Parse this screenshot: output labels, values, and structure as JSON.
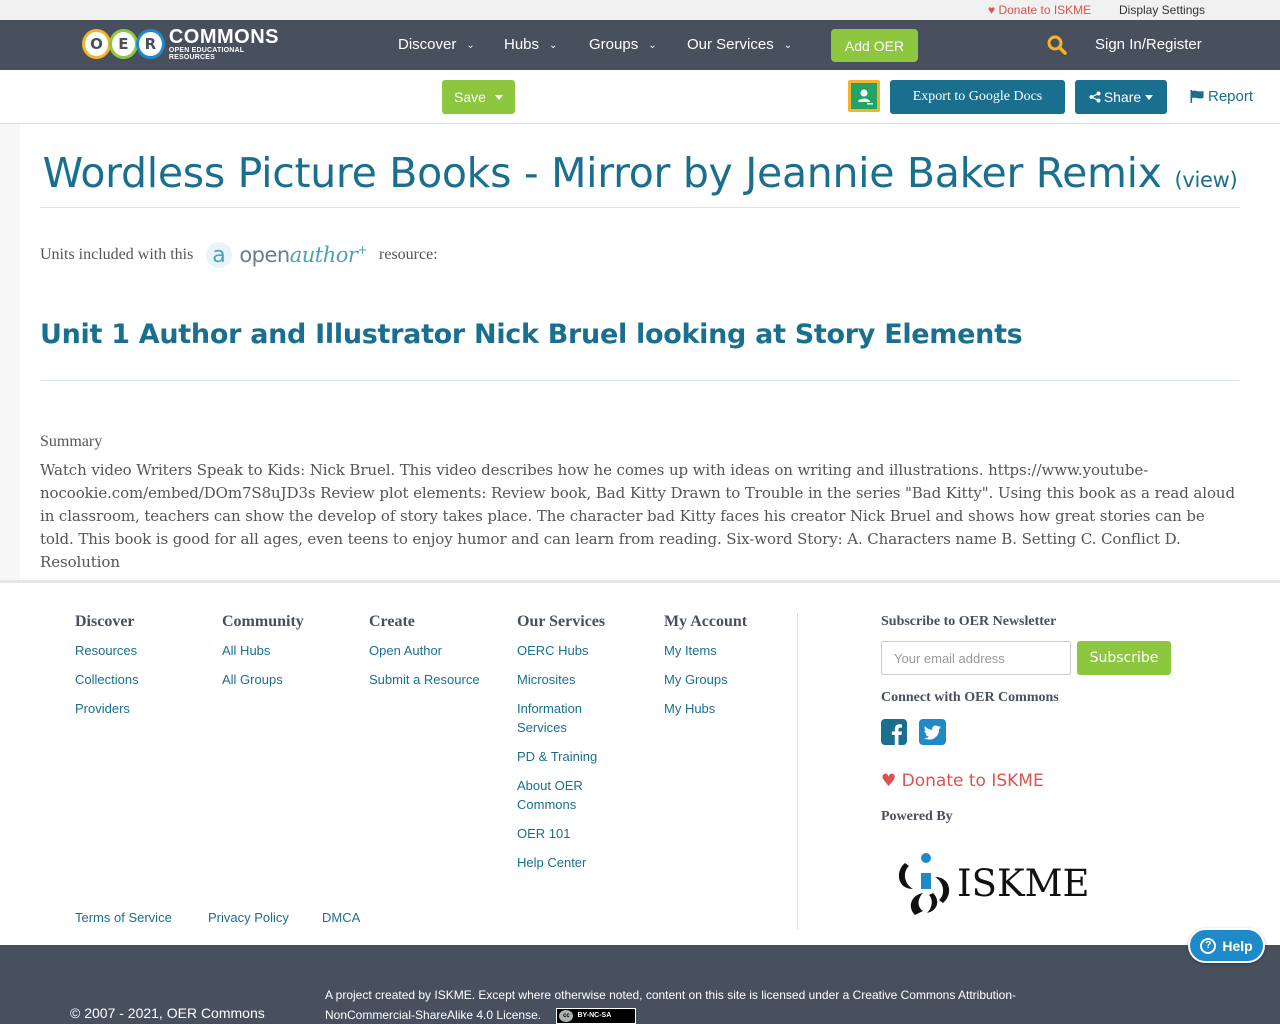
{
  "utility": {
    "donate": "Donate to ISKME",
    "display_settings": "Display Settings"
  },
  "nav": {
    "logo_text": "COMMONS",
    "logo_sub": "OPEN EDUCATIONAL RESOURCES",
    "logo_letters": [
      "O",
      "E",
      "R"
    ],
    "items": [
      "Discover",
      "Hubs",
      "Groups",
      "Our Services"
    ],
    "add_oer": "Add OER",
    "signin": "Sign In/Register"
  },
  "toolbar": {
    "save": "Save",
    "export": "Export to Google Docs",
    "share": "Share",
    "report": "Report"
  },
  "resource": {
    "title": "Wordless Picture Books - Mirror by Jeannie Baker Remix",
    "view_link": "(view)",
    "units_prefix": "Units included with this",
    "units_suffix": "resource:",
    "openauthor_open": "open",
    "openauthor_author": "author",
    "unit_title": "Unit 1 Author and Illustrator Nick Bruel looking at Story Elements",
    "summary_label": "Summary",
    "summary_text": "Watch video Writers Speak to Kids: Nick Bruel. This video describes how he comes up with ideas on writing and illustrations. https://www.youtube-nocookie.com/embed/DOm7S8uJD3s Review plot elements: Review book, Bad Kitty Drawn to Trouble in the series \"Bad Kitty\". Using this book as a read aloud in classroom, teachers can show the develop of story takes place. The character bad Kitty faces his creator Nick Bruel and shows how great stories can be told. This book is good for all ages, even teens to enjoy humor and can learn from reading. Six-word Story: A. Characters name B. Setting C. Conflict D. Resolution"
  },
  "footer": {
    "columns": [
      {
        "heading": "Discover",
        "links": [
          "Resources",
          "Collections",
          "Providers"
        ]
      },
      {
        "heading": "Community",
        "links": [
          "All Hubs",
          "All Groups"
        ]
      },
      {
        "heading": "Create",
        "links": [
          "Open Author",
          "Submit a Resource"
        ]
      },
      {
        "heading": "Our Services",
        "links": [
          "OERC Hubs",
          "Microsites",
          "Information Services",
          "PD & Training",
          "About OER Commons",
          "OER 101",
          "Help Center"
        ]
      },
      {
        "heading": "My Account",
        "links": [
          "My Items",
          "My Groups",
          "My Hubs"
        ]
      }
    ],
    "newsletter_heading": "Subscribe to OER Newsletter",
    "email_placeholder": "Your email address",
    "subscribe": "Subscribe",
    "connect_heading": "Connect with OER Commons",
    "donate": "Donate to ISKME",
    "powered_heading": "Powered By",
    "iskme_text": "ISKME",
    "legal": [
      "Terms of Service",
      "Privacy Policy",
      "DMCA"
    ]
  },
  "help": "Help",
  "bottom": {
    "copyright": "© 2007 - 2021, OER Commons",
    "license": "A project created by ISKME. Except where otherwise noted, content on this site is licensed under a Creative Commons Attribution-NonCommercial-ShareAlike 4.0 License.",
    "cc_badge": "BY-NC-SA"
  },
  "colors": {
    "nav_bg": "#48505e",
    "accent_blue": "#1a6f8f",
    "accent_green": "#8dc63f",
    "donate_red": "#d9534f"
  }
}
